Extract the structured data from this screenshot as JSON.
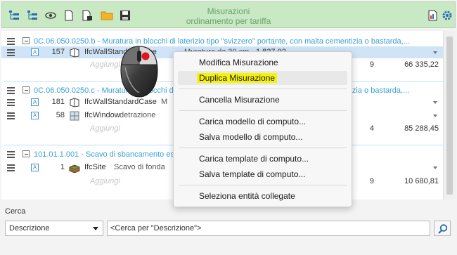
{
  "header": {
    "title_line1": "Misurazioni",
    "title_line2": "ordinamento per tariffa",
    "tools": [
      "expand-tree-icon",
      "collapse-tree-icon",
      "eye-icon",
      "new-document-icon",
      "document-add-icon",
      "folder-icon",
      "save-icon",
      "report-icon",
      "settings-icon"
    ]
  },
  "groups": [
    {
      "text": "0C.06.050.0250.b - Muratura in blocchi di laterizio tipo \"svizzero\" portante, con malta cementizia o bastarda,...",
      "rows": [
        {
          "qty": "157",
          "entity": "IfcWallStandardCase",
          "detail": "Muratura da 30 cm",
          "value": "1 827,02"
        }
      ],
      "add_label": "Aggiungi",
      "partial": "9",
      "total": "66 335,22"
    },
    {
      "text": "0C.06.050.0250.c - Muratura in blocchi di laterizio tipo \"svizzero\" portante, con malta cementizia o bastarda,...",
      "rows": [
        {
          "qty": "181",
          "entity": "IfcWallStandardCase",
          "detail": "M"
        },
        {
          "qty": "58",
          "entity": "IfcWindow",
          "detail": "detrazione"
        }
      ],
      "add_label": "Aggiungi",
      "partial": "4",
      "total": "85 288,45"
    },
    {
      "text": "101.01.1.001 - Scavo di sbancamento es",
      "rows": [
        {
          "qty": "1",
          "entity": "IfcSite",
          "detail": "Scavo di fonda"
        }
      ],
      "add_label": "Aggiungi",
      "partial": "9",
      "total": "10 680,81"
    }
  ],
  "context_menu": {
    "items": [
      "Modifica Misurazione",
      "Duplica Misurazione",
      "Cancella Misurazione",
      "Carica modello di computo...",
      "Salva modello di computo...",
      "Carica template di computo...",
      "Salva template di computo...",
      "Seleziona entità collegate"
    ],
    "highlighted": "Duplica Misurazione"
  },
  "search": {
    "label": "Cerca",
    "field": "Descrizione",
    "placeholder": "<Cerca per \"Descrizione\">"
  },
  "colors": {
    "toolbar_bg": "#c9e8c4",
    "group_text": "#3aa0d8",
    "selection": "#cfe4f7",
    "highlight": "#f7f20a"
  }
}
